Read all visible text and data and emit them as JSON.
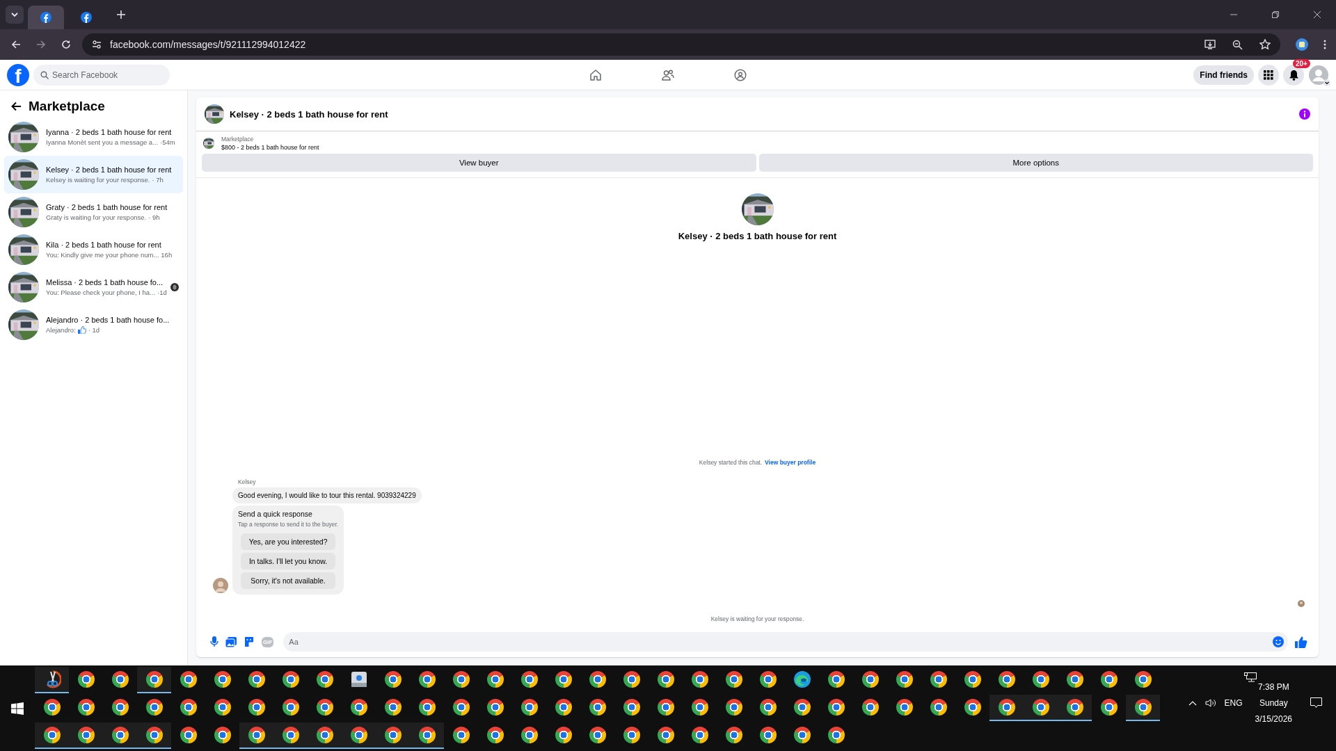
{
  "browser": {
    "tabs": [
      {
        "selected": true
      },
      {
        "selected": false
      }
    ],
    "url": "facebook.com/messages/t/921112994012422"
  },
  "header": {
    "logo": "f",
    "search_placeholder": "Search Facebook",
    "nav": [
      {
        "kind": "home"
      },
      {
        "kind": "friends"
      },
      {
        "kind": "groups"
      }
    ],
    "find_friends": "Find friends",
    "notification_badge": "20+"
  },
  "sidebar": {
    "title": "Marketplace",
    "conversations": [
      {
        "title": "Iyanna · 2 beds 1 bath house for rent",
        "preview": "Iyanna Monèt sent you a message a...",
        "time": "·54m",
        "selected": false,
        "liked": false,
        "seen": false
      },
      {
        "title": "Kelsey · 2 beds 1 bath house for rent",
        "preview": "Kelsey is waiting for your response.",
        "time": "· 7h",
        "selected": true,
        "liked": false,
        "seen": false
      },
      {
        "title": "Graty · 2 beds 1 bath house for rent",
        "preview": "Graty is waiting for your response.",
        "time": "· 9h",
        "selected": false,
        "liked": false,
        "seen": false
      },
      {
        "title": "Kila · 2 beds 1 bath house for rent",
        "preview": "You: Kindly give me your phone num...",
        "time": "16h",
        "selected": false,
        "liked": false,
        "seen": false
      },
      {
        "title": "Melissa · 2 beds 1 bath house fo...",
        "preview": "You: Please check your phone, I ha...",
        "time": "·1d",
        "selected": false,
        "liked": false,
        "seen": true
      },
      {
        "title": "Alejandro · 2 beds 1 bath house fo...",
        "preview": "Alejandro:",
        "time": "· 1d",
        "selected": false,
        "liked": true,
        "seen": false
      }
    ]
  },
  "chat": {
    "title": "Kelsey · 2 beds 1 bath house for rent",
    "listing_label": "Marketplace",
    "listing": "$800 - 2 beds 1 bath house for rent",
    "actions": [
      "View buyer",
      "More options"
    ],
    "intro_title": "Kelsey · 2 beds 1 bath house for rent",
    "started": "Kelsey started this chat.",
    "started_link": "View buyer profile",
    "sender": "Kelsey",
    "message": "Good evening, I would like to tour this rental. 9039324229",
    "quick_title": "Send a quick response",
    "quick_subtitle": "Tap a response to send it to the buyer.",
    "quick_options": [
      "Yes, are you interested?",
      "In talks. I'll let you know.",
      "Sorry, it's not available."
    ],
    "waiting": "Kelsey is waiting for your response.",
    "gif_label": "GIF",
    "composer_placeholder": "Aa"
  },
  "taskbar": {
    "rows": [
      [
        {
          "kind": "snip",
          "running": true
        },
        {
          "kind": "chrome",
          "running": false
        },
        {
          "kind": "chrome",
          "running": false
        },
        {
          "kind": "chrome",
          "running": true
        },
        {
          "kind": "chrome",
          "running": false
        },
        {
          "kind": "chrome",
          "running": false
        },
        {
          "kind": "chrome",
          "running": false
        },
        {
          "kind": "chrome",
          "running": false
        },
        {
          "kind": "chrome",
          "running": false
        },
        {
          "kind": "app",
          "running": false
        },
        {
          "kind": "chrome",
          "running": false
        },
        {
          "kind": "chrome",
          "running": false
        },
        {
          "kind": "chrome",
          "running": false
        },
        {
          "kind": "chrome",
          "running": false
        },
        {
          "kind": "chrome",
          "running": false
        },
        {
          "kind": "chrome",
          "running": false
        },
        {
          "kind": "chrome",
          "running": false
        },
        {
          "kind": "chrome",
          "running": false
        },
        {
          "kind": "chrome",
          "running": false
        },
        {
          "kind": "chrome",
          "running": false
        },
        {
          "kind": "chrome",
          "running": false
        },
        {
          "kind": "chrome",
          "running": false
        },
        {
          "kind": "edge",
          "running": false
        },
        {
          "kind": "chrome",
          "running": false
        },
        {
          "kind": "chrome",
          "running": false
        },
        {
          "kind": "chrome",
          "running": false
        },
        {
          "kind": "chrome",
          "running": false
        },
        {
          "kind": "chrome",
          "running": false
        },
        {
          "kind": "chrome",
          "running": false
        },
        {
          "kind": "chrome",
          "running": false
        },
        {
          "kind": "chrome",
          "running": false
        },
        {
          "kind": "chrome",
          "running": false
        },
        {
          "kind": "chrome",
          "running": false
        }
      ],
      [
        {
          "kind": "chrome",
          "running": false
        },
        {
          "kind": "chrome",
          "running": false
        },
        {
          "kind": "chrome",
          "running": false
        },
        {
          "kind": "chrome",
          "running": false
        },
        {
          "kind": "chrome",
          "running": false
        },
        {
          "kind": "chrome",
          "running": false
        },
        {
          "kind": "chrome",
          "running": false
        },
        {
          "kind": "chrome",
          "running": false
        },
        {
          "kind": "chrome",
          "running": false
        },
        {
          "kind": "chrome",
          "running": false
        },
        {
          "kind": "chrome",
          "running": false
        },
        {
          "kind": "chrome",
          "running": false
        },
        {
          "kind": "chrome",
          "running": false
        },
        {
          "kind": "chrome",
          "running": false
        },
        {
          "kind": "chrome",
          "running": false
        },
        {
          "kind": "chrome",
          "running": false
        },
        {
          "kind": "chrome",
          "running": false
        },
        {
          "kind": "chrome",
          "running": false
        },
        {
          "kind": "chrome",
          "running": false
        },
        {
          "kind": "chrome",
          "running": false
        },
        {
          "kind": "chrome",
          "running": false
        },
        {
          "kind": "chrome",
          "running": false
        },
        {
          "kind": "chrome",
          "running": false
        },
        {
          "kind": "chrome",
          "running": false
        },
        {
          "kind": "chrome",
          "running": false
        },
        {
          "kind": "chrome",
          "running": false
        },
        {
          "kind": "chrome",
          "running": false
        },
        {
          "kind": "chrome",
          "running": false
        },
        {
          "kind": "chrome",
          "running": true
        },
        {
          "kind": "chrome",
          "running": true
        },
        {
          "kind": "chrome",
          "running": true
        },
        {
          "kind": "chrome",
          "running": false
        },
        {
          "kind": "chrome",
          "running": true
        }
      ],
      [
        {
          "kind": "chrome",
          "running": true
        },
        {
          "kind": "chrome",
          "running": true
        },
        {
          "kind": "chrome",
          "running": true
        },
        {
          "kind": "chrome",
          "running": true
        },
        {
          "kind": "chrome",
          "running": false
        },
        {
          "kind": "chrome",
          "running": false
        },
        {
          "kind": "chrome",
          "running": true
        },
        {
          "kind": "chrome",
          "running": true
        },
        {
          "kind": "chrome",
          "running": true
        },
        {
          "kind": "chrome",
          "running": true
        },
        {
          "kind": "chrome",
          "running": true
        },
        {
          "kind": "chrome",
          "running": true
        },
        {
          "kind": "chrome",
          "running": false
        },
        {
          "kind": "chrome",
          "running": false
        },
        {
          "kind": "chrome",
          "running": false
        },
        {
          "kind": "chrome",
          "running": false
        },
        {
          "kind": "chrome",
          "running": false
        },
        {
          "kind": "chrome",
          "running": false
        },
        {
          "kind": "chrome",
          "running": false
        },
        {
          "kind": "chrome",
          "running": false
        },
        {
          "kind": "chrome",
          "running": false
        },
        {
          "kind": "chrome",
          "running": false
        },
        {
          "kind": "chrome",
          "running": false
        },
        {
          "kind": "chrome",
          "running": false
        }
      ]
    ],
    "language": "ENG",
    "time": "7:38 PM",
    "day": "Sunday",
    "date": "3/15/2026"
  }
}
